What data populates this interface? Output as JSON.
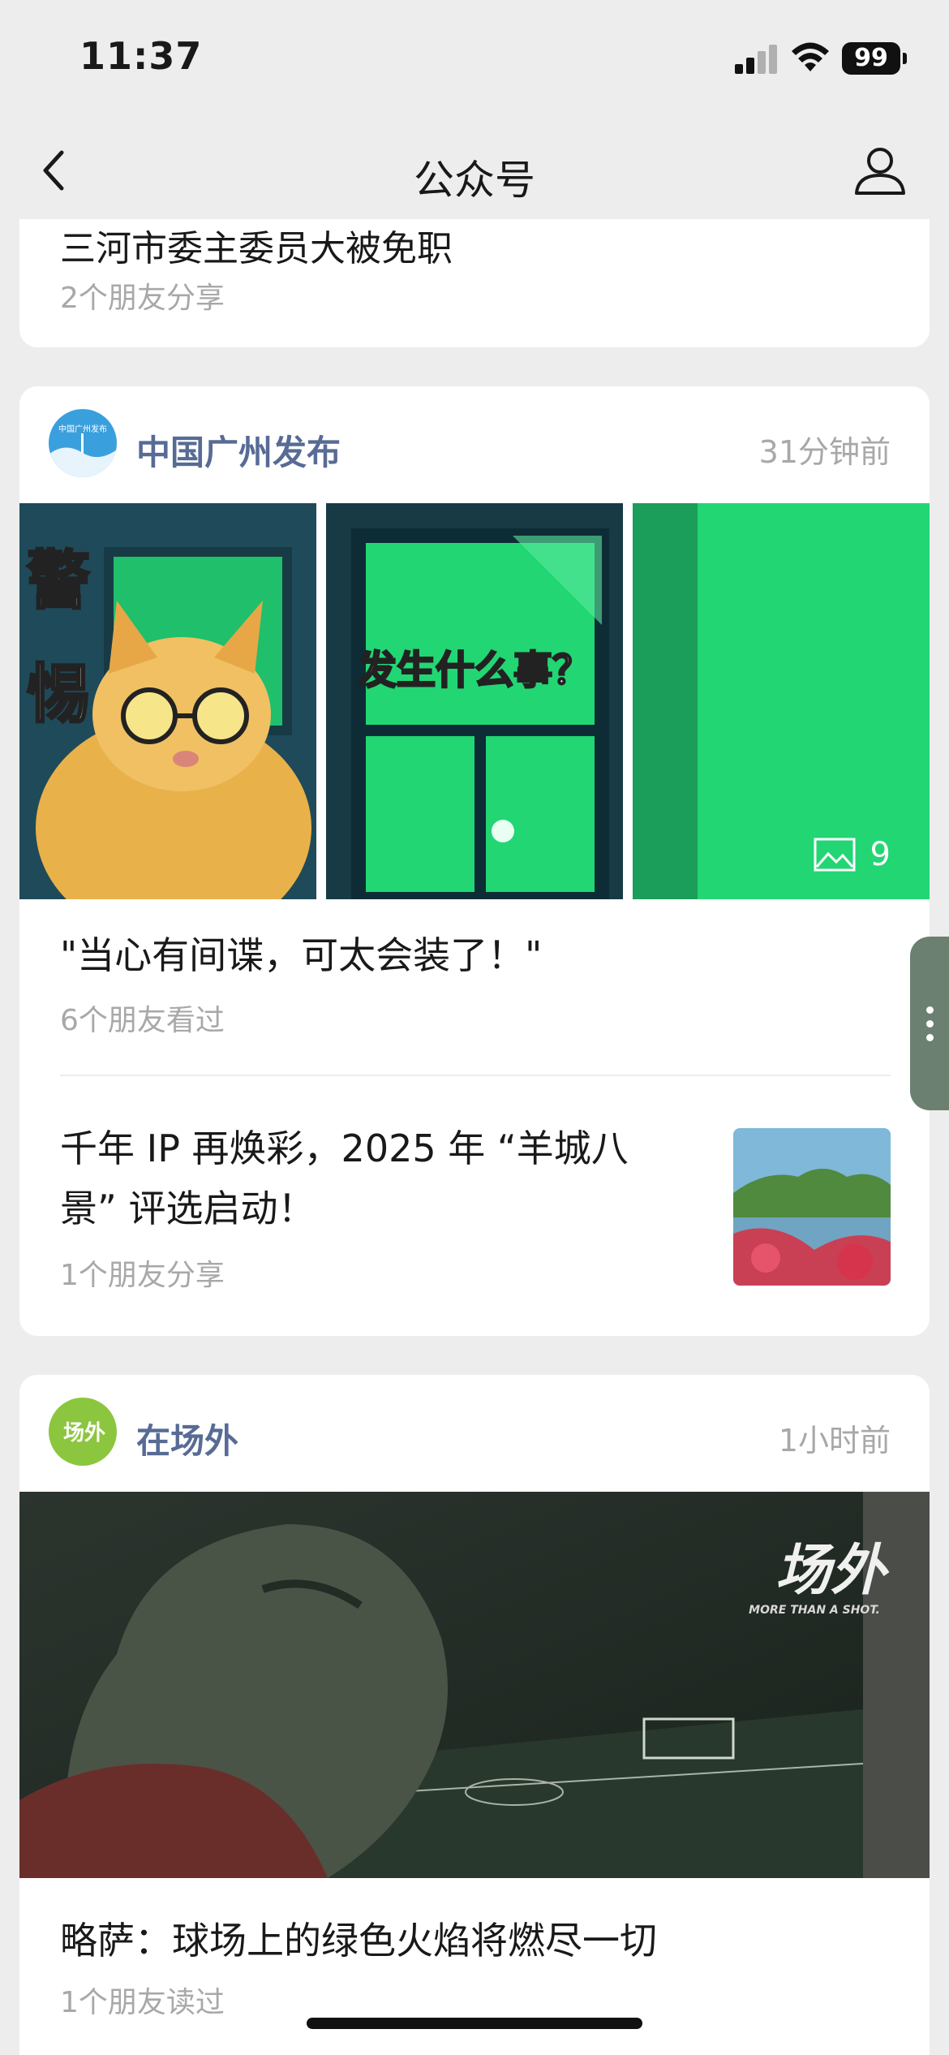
{
  "status": {
    "time": "11:37",
    "battery": "99"
  },
  "nav": {
    "title": "公众号"
  },
  "feed": {
    "partial_card": {
      "title": "三河市委主委员大被免职",
      "meta": "2个朋友分享"
    },
    "cards": [
      {
        "account": "中国广州发布",
        "time": "31分钟前",
        "avatar_text": "中国广州发布",
        "images": [
          {
            "caption_top": "警",
            "caption_bottom": "惕"
          },
          {
            "caption": "发生什么事？"
          },
          {
            "caption": ""
          }
        ],
        "photo_count": "9",
        "articles": [
          {
            "title": "\"当心有间谍，可太会装了！\"",
            "meta": "6个朋友看过"
          },
          {
            "title_line1": "千年 IP 再焕彩，2025 年 “羊城八",
            "title_line2": "景” 评选启动！",
            "meta": "1个朋友分享"
          }
        ]
      },
      {
        "account": "在场外",
        "time": "1小时前",
        "avatar_text": "场外",
        "cover_logo": "场外",
        "cover_logo_sub": "MORE THAN A SHOT.",
        "articles": [
          {
            "title": "略萨：球场上的绿色火焰将燃尽一切",
            "meta": "1个朋友读过"
          }
        ]
      }
    ]
  },
  "colors": {
    "account_name": "#576b95",
    "meta": "#a8a8a8",
    "page_bg": "#ededed",
    "card_bg": "#ffffff"
  },
  "icons": [
    "back-chevron-icon",
    "profile-icon",
    "image-gallery-icon",
    "more-vertical-icon"
  ]
}
